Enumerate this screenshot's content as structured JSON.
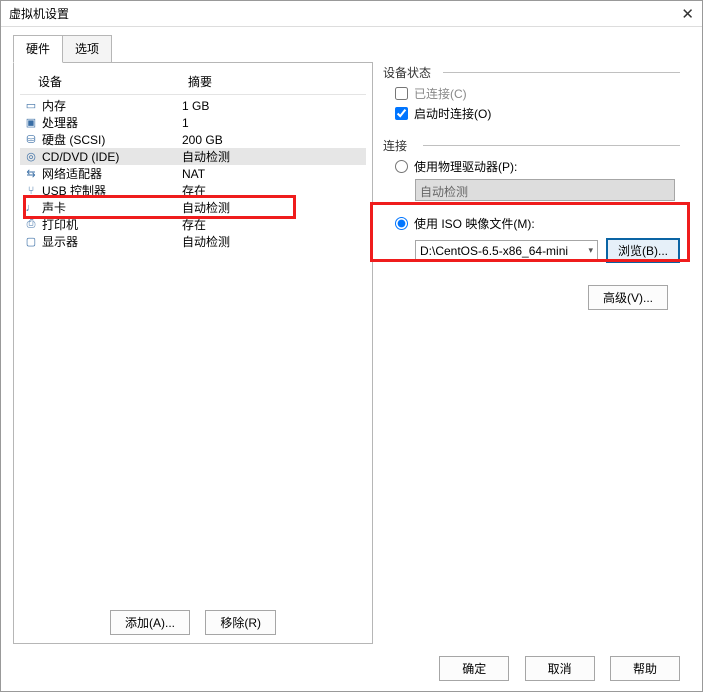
{
  "window": {
    "title": "虚拟机设置",
    "close_icon": "✕"
  },
  "tabs": {
    "hardware": "硬件",
    "options": "选项"
  },
  "device_table": {
    "header_device": "设备",
    "header_summary": "摘要",
    "rows": [
      {
        "icon": "memory-icon",
        "label": "内存",
        "summary": "1 GB"
      },
      {
        "icon": "cpu-icon",
        "label": "处理器",
        "summary": "1"
      },
      {
        "icon": "disk-icon",
        "label": "硬盘 (SCSI)",
        "summary": "200 GB"
      },
      {
        "icon": "cd-icon",
        "label": "CD/DVD (IDE)",
        "summary": "自动检测"
      },
      {
        "icon": "net-icon",
        "label": "网络适配器",
        "summary": "NAT"
      },
      {
        "icon": "usb-icon",
        "label": "USB 控制器",
        "summary": "存在"
      },
      {
        "icon": "sound-icon",
        "label": "声卡",
        "summary": "自动检测"
      },
      {
        "icon": "printer-icon",
        "label": "打印机",
        "summary": "存在"
      },
      {
        "icon": "display-icon",
        "label": "显示器",
        "summary": "自动检测"
      }
    ],
    "selected_index": 3
  },
  "left_buttons": {
    "add": "添加(A)...",
    "remove": "移除(R)"
  },
  "panel_status": {
    "legend": "设备状态",
    "connected_label": "已连接(C)",
    "connected_checked": false,
    "connect_at_power_label": "启动时连接(O)",
    "connect_at_power_checked": true
  },
  "panel_connection": {
    "legend": "连接",
    "use_physical_label": "使用物理驱动器(P):",
    "physical_value": "自动检测",
    "use_iso_label": "使用 ISO 映像文件(M):",
    "iso_path": "D:\\CentOS-6.5-x86_64-mini",
    "browse_label": "浏览(B)...",
    "selected": "iso"
  },
  "advanced_button": "高级(V)...",
  "footer": {
    "ok": "确定",
    "cancel": "取消",
    "help": "帮助"
  }
}
